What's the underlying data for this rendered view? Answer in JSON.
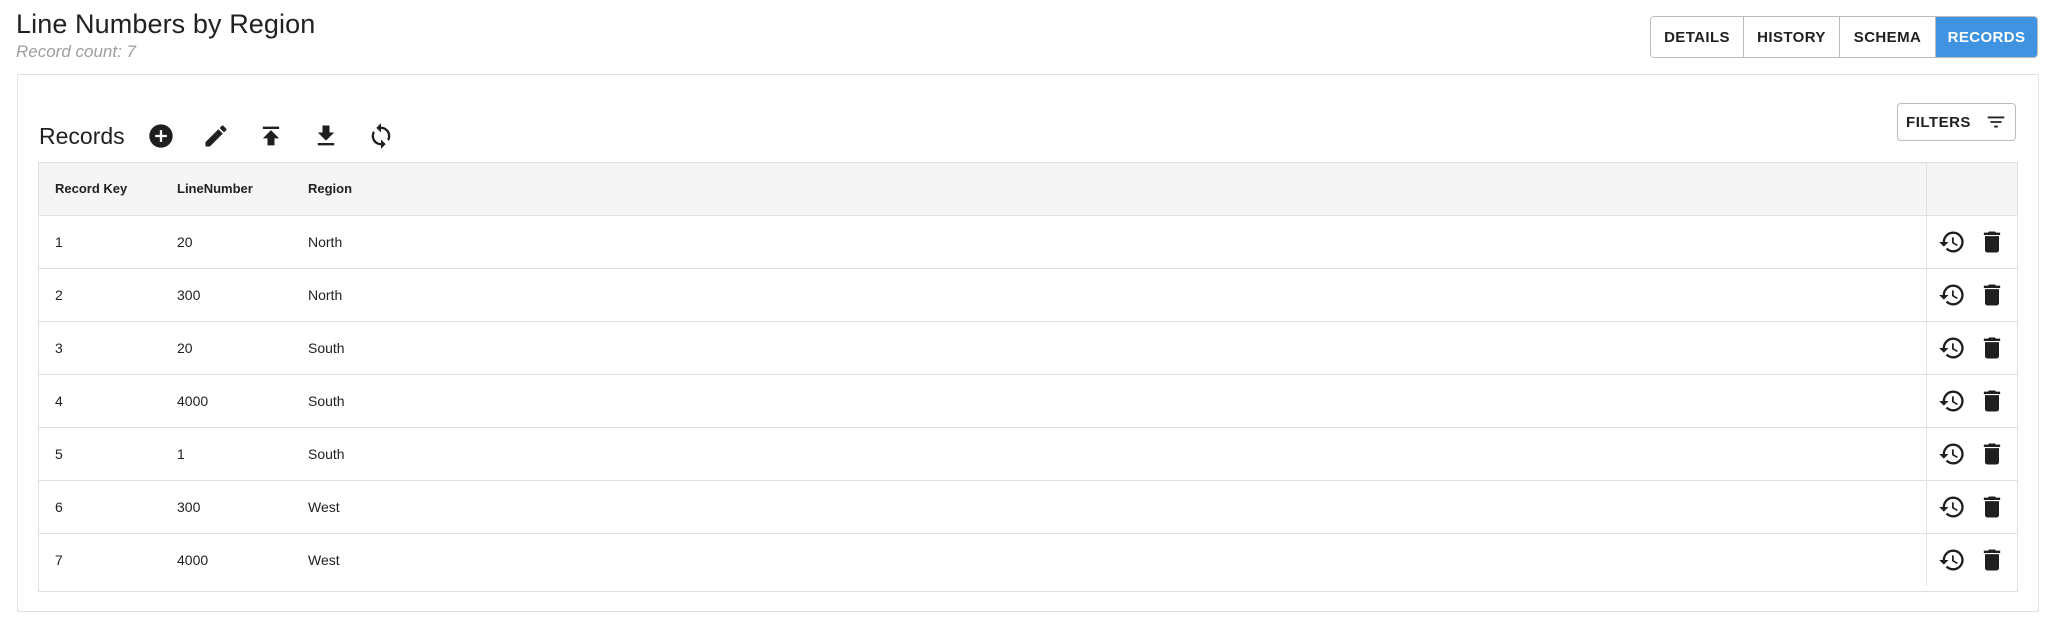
{
  "page": {
    "title": "Line Numbers by Region",
    "record_count": "Record count: 7"
  },
  "tabs": [
    {
      "label": "DETAILS",
      "active": false
    },
    {
      "label": "HISTORY",
      "active": false
    },
    {
      "label": "SCHEMA",
      "active": false
    },
    {
      "label": "RECORDS",
      "active": true
    }
  ],
  "toolbar": {
    "title": "Records",
    "icons": [
      "add-circle-icon",
      "edit-pencil-icon",
      "upload-icon",
      "download-icon",
      "refresh-icon"
    ],
    "filters_label": "FILTERS"
  },
  "table": {
    "columns": [
      "Record Key",
      "LineNumber",
      "Region"
    ],
    "rows": [
      {
        "key": "1",
        "line": "20",
        "region": "North"
      },
      {
        "key": "2",
        "line": "300",
        "region": "North"
      },
      {
        "key": "3",
        "line": "20",
        "region": "South"
      },
      {
        "key": "4",
        "line": "4000",
        "region": "South"
      },
      {
        "key": "5",
        "line": "1",
        "region": "South"
      },
      {
        "key": "6",
        "line": "300",
        "region": "West"
      },
      {
        "key": "7",
        "line": "4000",
        "region": "West"
      }
    ],
    "row_actions": [
      "history-icon",
      "delete-icon"
    ]
  },
  "colors": {
    "accent": "#3f93e0",
    "border": "#e0e0e0",
    "header_bg": "#f5f5f5",
    "muted_text": "#9e9e9e"
  }
}
